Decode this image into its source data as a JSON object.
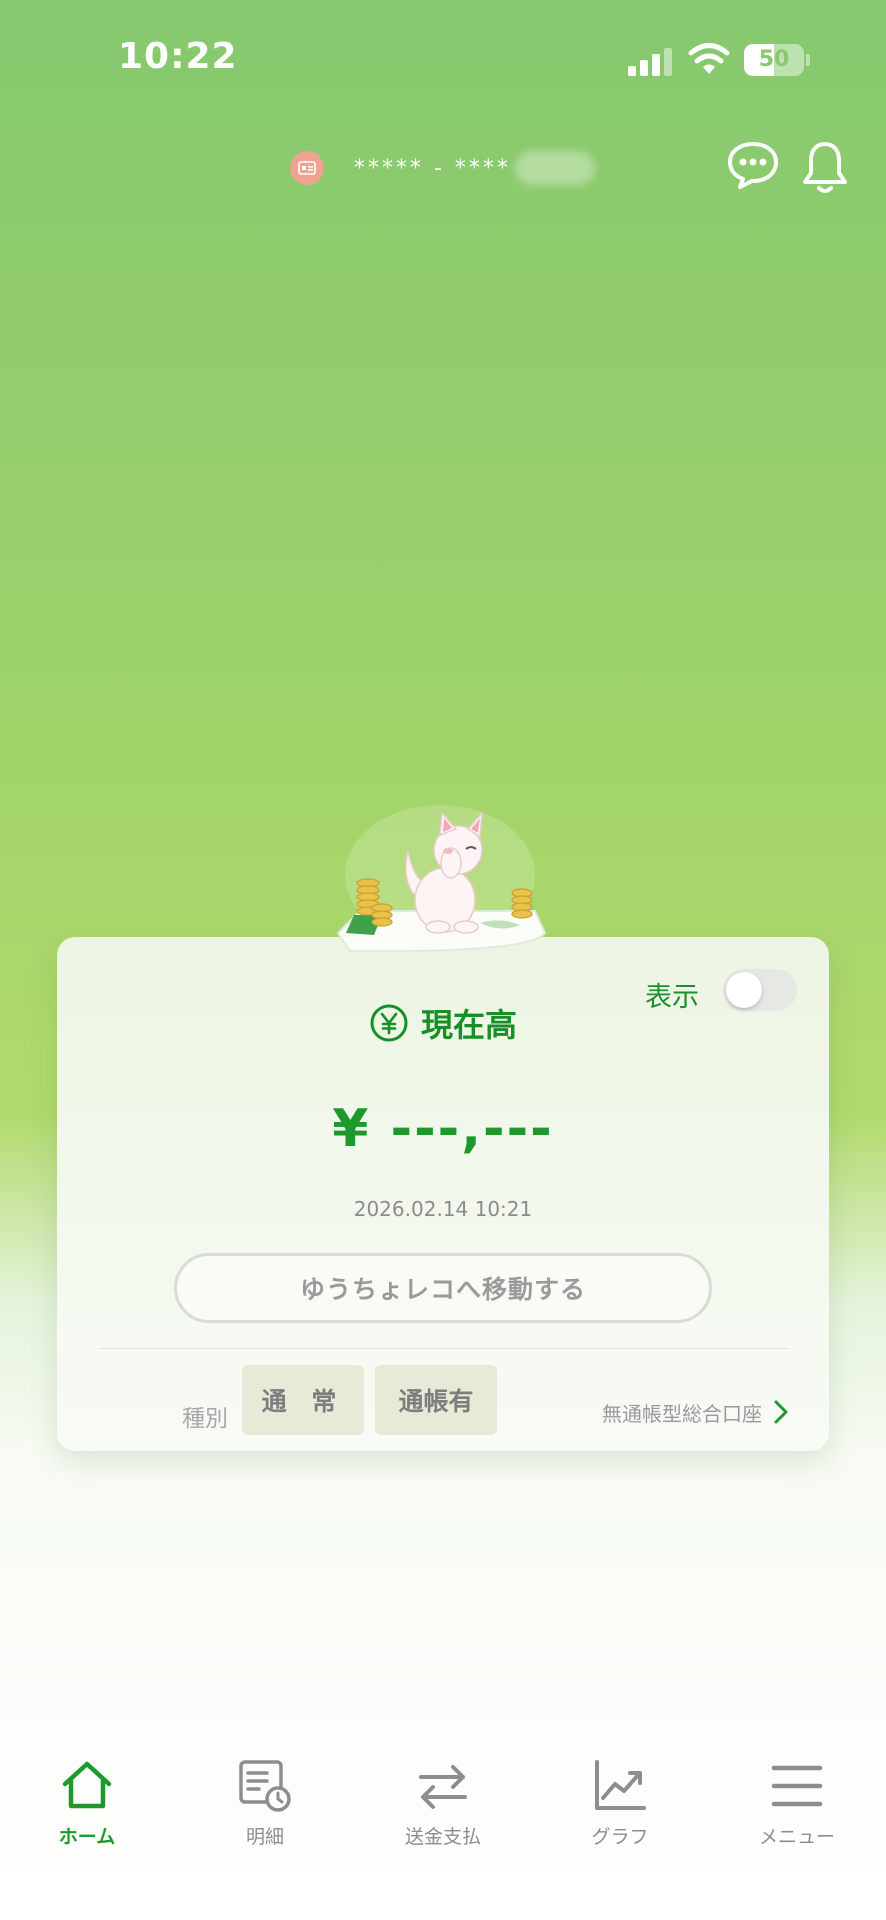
{
  "status_bar": {
    "time": "10:22",
    "battery": "50",
    "battery_level": 0.5
  },
  "header": {
    "account_number": "***** - ****"
  },
  "balance_card": {
    "display_label": "表示",
    "display_toggle_on": false,
    "title": "現在高",
    "amount": "¥ ---,---",
    "date": "2026.02.14 10:21",
    "reco_button": "ゆうちょレコへ移動する",
    "type_label": "種別",
    "chips": [
      "通 常",
      "通帳有"
    ],
    "account_type_link": "無通帳型総合口座"
  },
  "tab_bar": {
    "items": [
      {
        "label": "ホーム",
        "icon": "home-icon",
        "active": true
      },
      {
        "label": "明細",
        "icon": "statement-icon",
        "active": false
      },
      {
        "label": "送金支払",
        "icon": "transfer-icon",
        "active": false
      },
      {
        "label": "グラフ",
        "icon": "chart-icon",
        "active": false
      },
      {
        "label": "メニュー",
        "icon": "menu-icon",
        "active": false
      }
    ]
  },
  "colors": {
    "accent": "#1e9a2c",
    "background_top": "#86c86f",
    "inactive": "#8d8d8d"
  }
}
